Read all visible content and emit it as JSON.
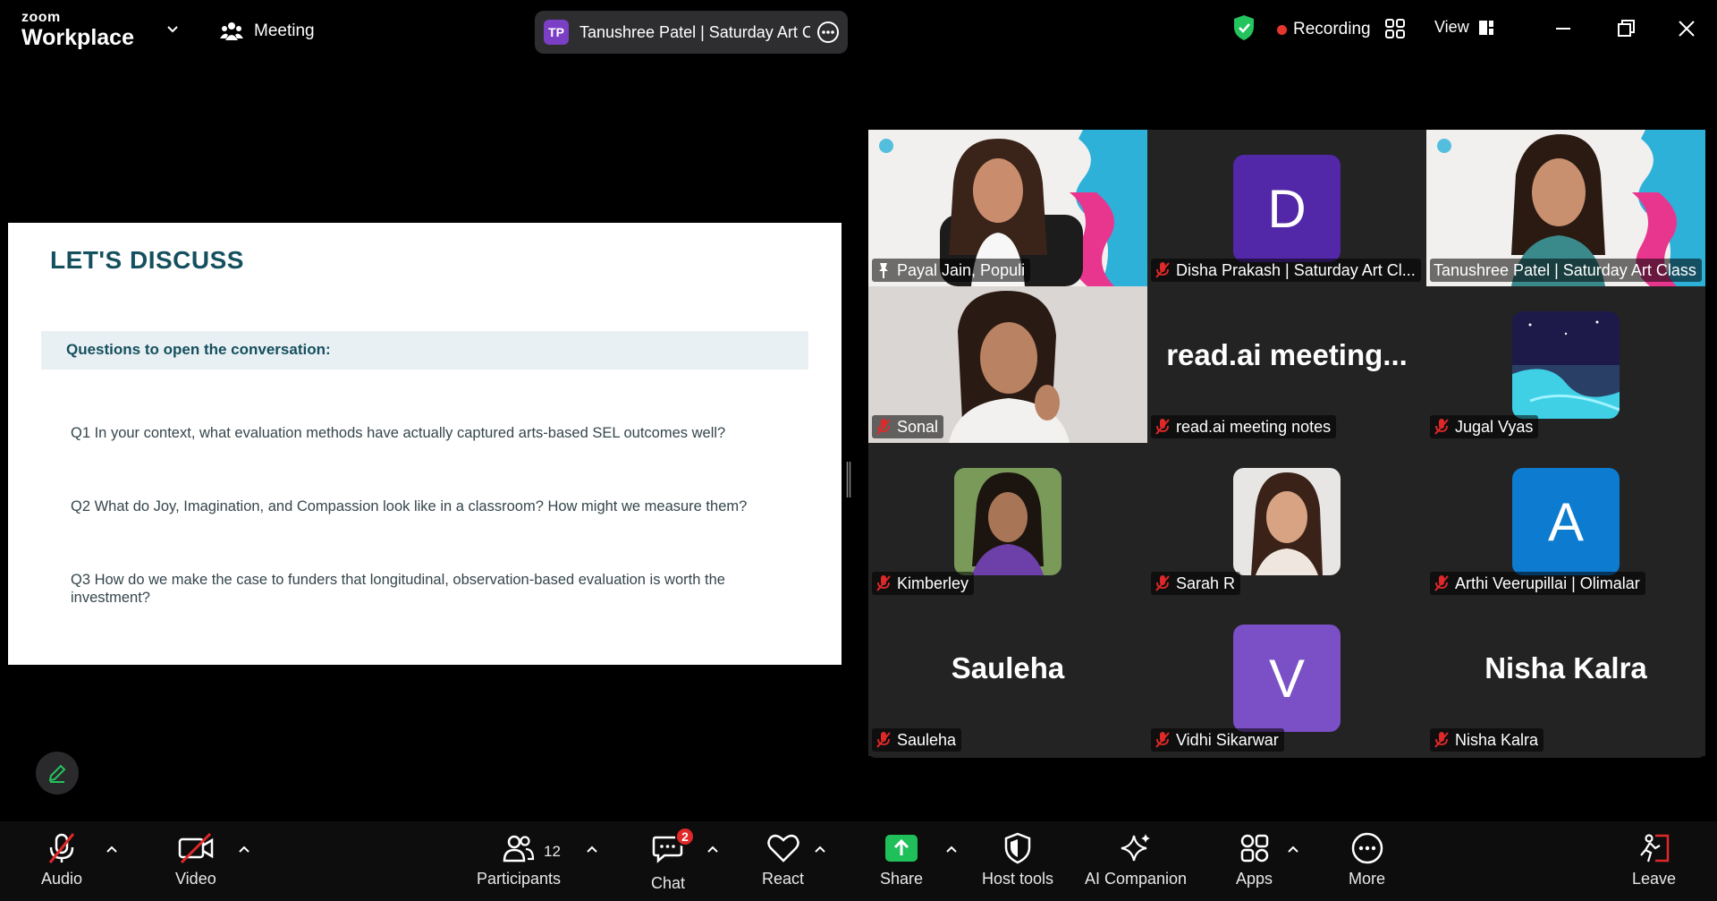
{
  "app": {
    "brand_small": "zoom",
    "brand_big": "Workplace"
  },
  "topbar": {
    "meeting_label": "Meeting",
    "host_initials": "TP",
    "host_name": "Tanushree Patel | Saturday Art Cla",
    "recording_label": "Recording",
    "view_label": "View"
  },
  "slide": {
    "title": "LET'S DISCUSS",
    "band": "Questions to open the conversation:",
    "q1": "Q1  In your context, what evaluation methods have actually captured arts-based SEL outcomes well?",
    "q2": "Q2  What do Joy, Imagination, and Compassion look like in a classroom? How might we measure them?",
    "q3": "Q3  How do we make the case to funders that longitudinal, observation-based evaluation is worth the investment?"
  },
  "participants": [
    {
      "name": "Payal Jain, Populi",
      "video": true,
      "active": true,
      "mic": "pinned"
    },
    {
      "name": "Disha Prakash | Saturday Art Cl...",
      "initial": "D",
      "avatar_color": "#5227a8",
      "mic": "off"
    },
    {
      "name": "Tanushree Patel | Saturday Art Class",
      "video": true,
      "mic": "none"
    },
    {
      "name": "Sonal",
      "video": true,
      "mic": "off"
    },
    {
      "name": "read.ai meeting notes",
      "display_text": "read.ai  meeting...",
      "mic": "off"
    },
    {
      "name": "Jugal Vyas",
      "photo": true,
      "mic": "off"
    },
    {
      "name": "Kimberley",
      "photo": true,
      "mic": "off"
    },
    {
      "name": "Sarah R",
      "photo": true,
      "mic": "off"
    },
    {
      "name": "Arthi Veerupillai | Olimalar",
      "initial": "A",
      "avatar_color": "#0d7bd0",
      "mic": "off"
    },
    {
      "name": "Sauleha",
      "display_text": "Sauleha",
      "mic": "off"
    },
    {
      "name": "Vidhi Sikarwar",
      "initial": "V",
      "avatar_color": "#7b4fc6",
      "mic": "off"
    },
    {
      "name": "Nisha Kalra",
      "display_text": "Nisha Kalra",
      "mic": "off"
    }
  ],
  "toolbar": {
    "audio": "Audio",
    "video": "Video",
    "participants": "Participants",
    "participants_count": "12",
    "chat": "Chat",
    "chat_badge": "2",
    "react": "React",
    "share": "Share",
    "host_tools": "Host tools",
    "ai_companion": "AI Companion",
    "apps": "Apps",
    "more": "More",
    "leave": "Leave"
  },
  "colors": {
    "active_speaker": "#23d96b",
    "share_green": "#1fbf5a",
    "recording_red": "#e5362e",
    "badge_red": "#e02828"
  }
}
